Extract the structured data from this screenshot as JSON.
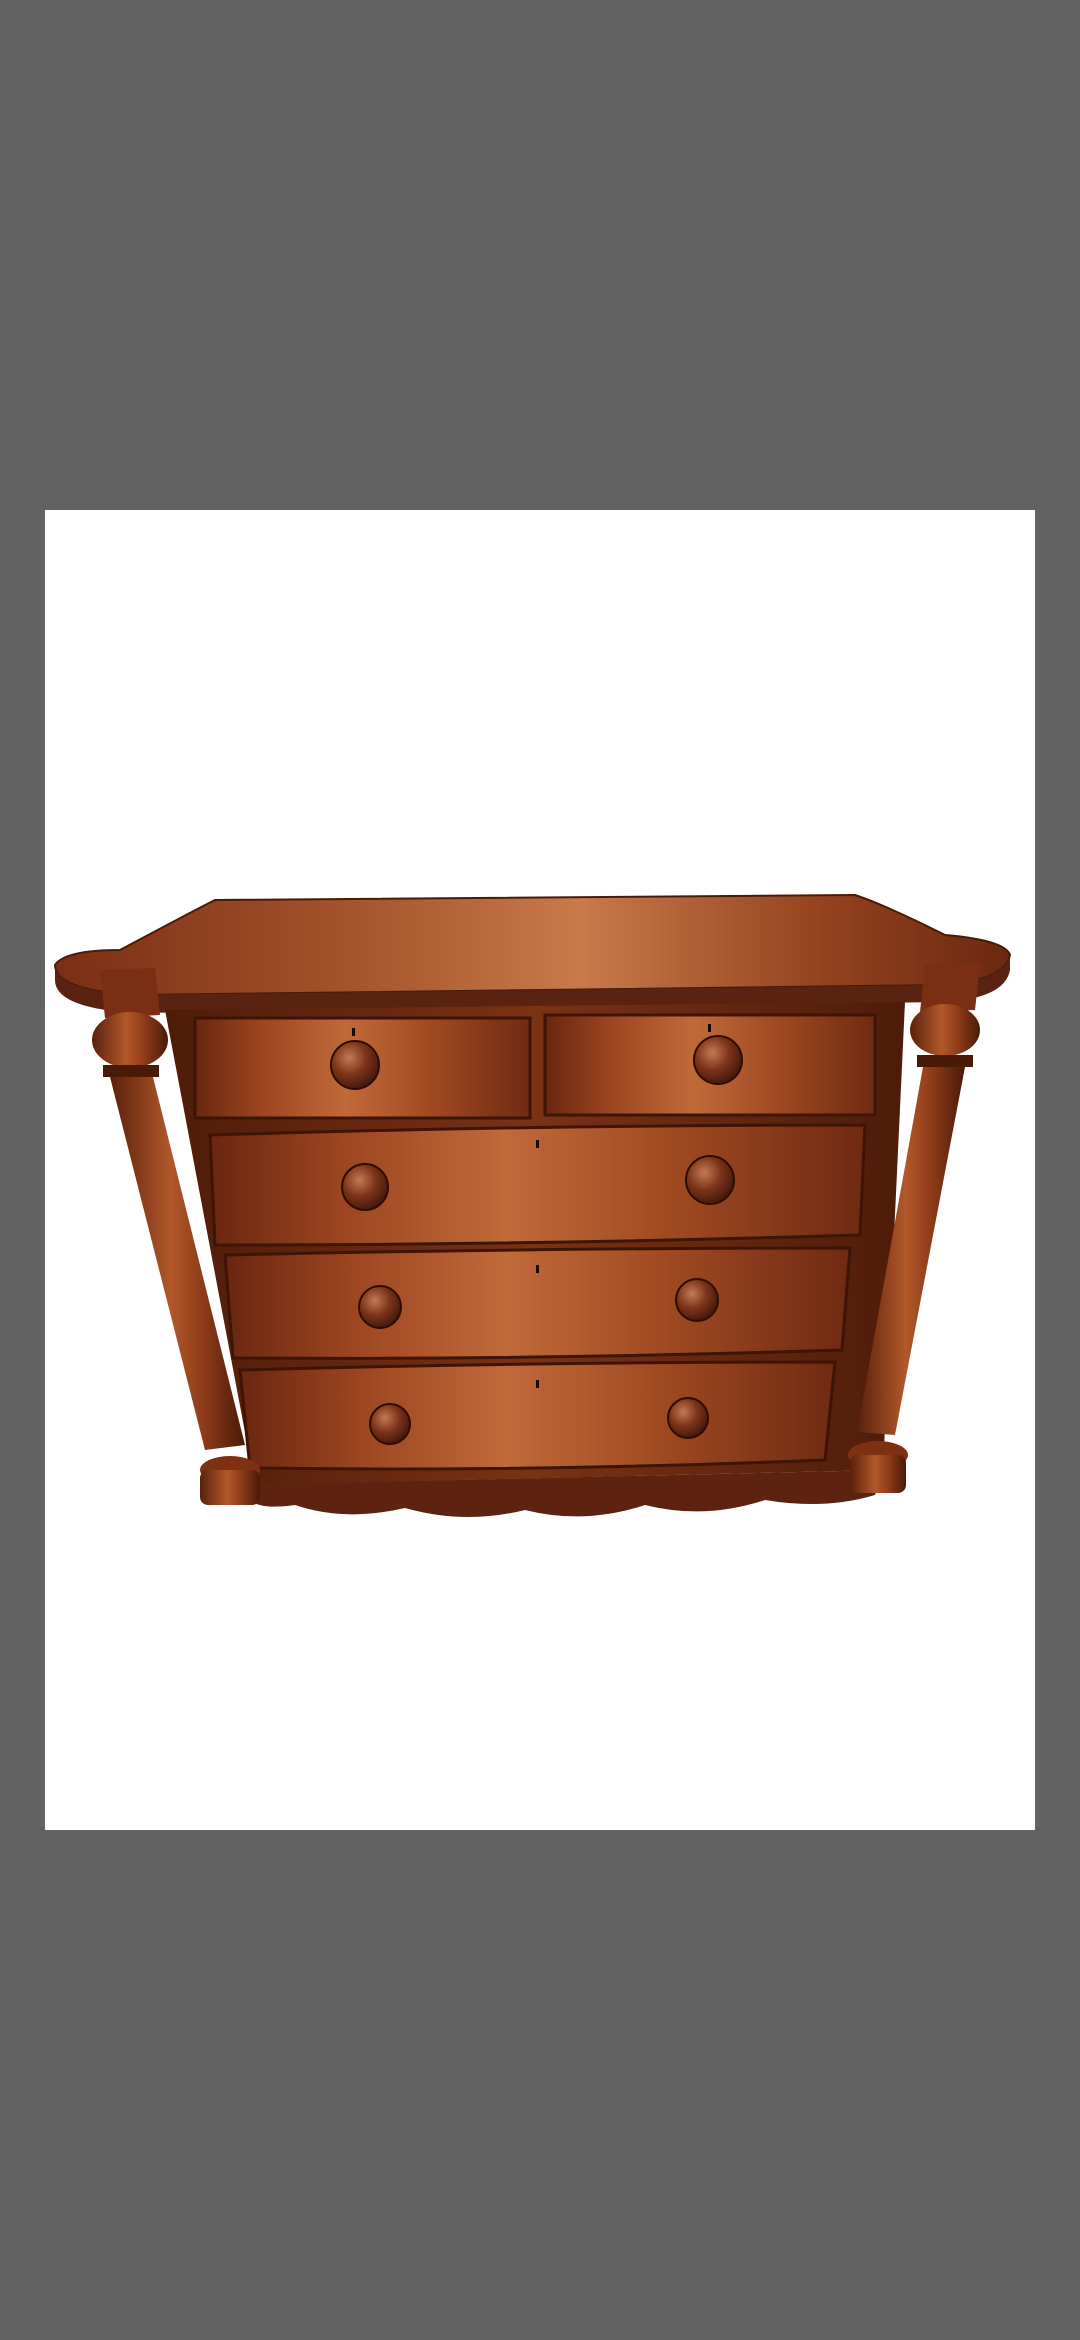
{
  "viewer": {
    "background": "#626262",
    "image": {
      "subject": "antique-bow-front-chest-of-drawers",
      "icon": "photo-icon",
      "colors": {
        "backdrop": "#ffffff",
        "wood_light": "#b5582c",
        "wood_mid": "#8a3a1c",
        "wood_dark": "#4a1a0c",
        "knob": "#6e2c16"
      },
      "drawer_rows": 4,
      "top_row_drawers": 2
    }
  }
}
